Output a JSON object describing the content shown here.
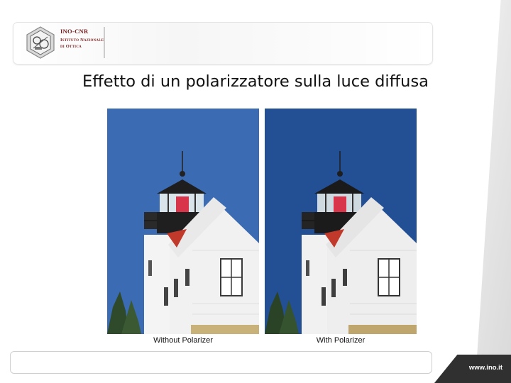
{
  "header": {
    "logo_name": "INO-CNR",
    "logo_subtitle": "Istituto Nazionale di Ottica"
  },
  "slide": {
    "title": "Effetto di un polarizzatore sulla luce diffusa"
  },
  "photos": [
    {
      "caption": "Without Polarizer",
      "sky_color": "#3b6bb3"
    },
    {
      "caption": "With Polarizer",
      "sky_color": "#234f94"
    }
  ],
  "footer": {
    "url": "www.ino.it"
  },
  "colors": {
    "brand": "#7a1a1a",
    "roof_red": "#c0392b",
    "lantern_red": "#d8344a"
  }
}
